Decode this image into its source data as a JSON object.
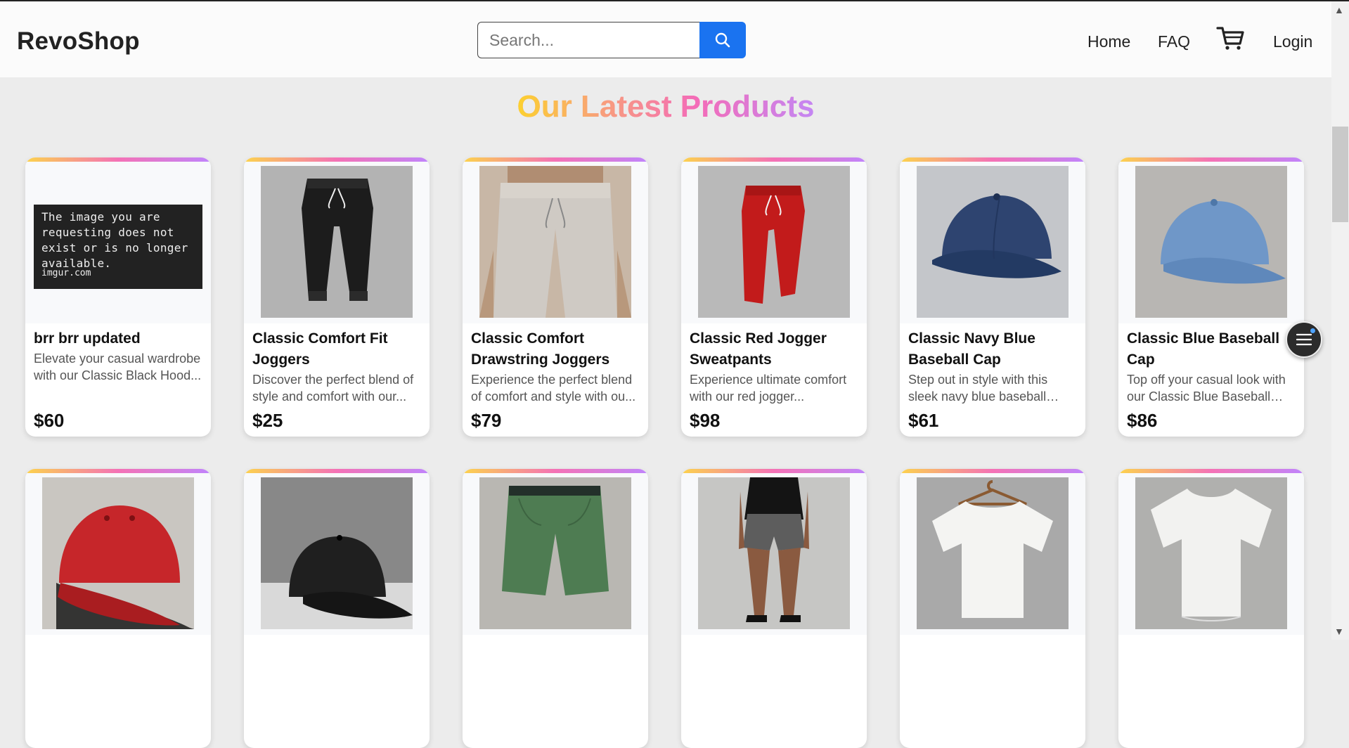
{
  "header": {
    "logo": "RevoShop",
    "search_placeholder": "Search...",
    "nav": {
      "home": "Home",
      "faq": "FAQ",
      "login": "Login"
    }
  },
  "section_title": "Our Latest Products",
  "broken_image": {
    "message": "The image you are requesting does not exist or is no longer available.",
    "site": "imgur.com"
  },
  "products": [
    {
      "name": "brr brr updated",
      "desc": "Elevate your casual wardrobe with our Classic Black Hood...",
      "price": "$60",
      "image": "broken-image"
    },
    {
      "name": "Classic Comfort Fit Joggers",
      "desc": "Discover the perfect blend of style and comfort with our...",
      "price": "$25",
      "image": "black-joggers"
    },
    {
      "name": "Classic Comfort Drawstring Joggers",
      "desc": "Experience the perfect blend of comfort and style with ou...",
      "price": "$79",
      "image": "grey-joggers"
    },
    {
      "name": "Classic Red Jogger Sweatpants",
      "desc": "Experience ultimate comfort with our red jogger...",
      "price": "$98",
      "image": "red-joggers"
    },
    {
      "name": "Classic Navy Blue Baseball Cap",
      "desc": "Step out in style with this sleek navy blue baseball cap...",
      "price": "$61",
      "image": "navy-cap"
    },
    {
      "name": "Classic Blue Baseball Cap",
      "desc": "Top off your casual look with our Classic Blue Baseball Ca...",
      "price": "$86",
      "image": "blue-cap"
    },
    {
      "name": "",
      "desc": "",
      "price": "",
      "image": "red-cap"
    },
    {
      "name": "",
      "desc": "",
      "price": "",
      "image": "black-cap"
    },
    {
      "name": "",
      "desc": "",
      "price": "",
      "image": "green-shorts"
    },
    {
      "name": "",
      "desc": "",
      "price": "",
      "image": "woman-shorts"
    },
    {
      "name": "",
      "desc": "",
      "price": "",
      "image": "white-tshirt-hanger"
    },
    {
      "name": "",
      "desc": "",
      "price": "",
      "image": "white-tshirt"
    }
  ],
  "colors": {
    "accent": "#1a73f0",
    "gradient": [
      "#fcd34d",
      "#f472b6",
      "#c084fc"
    ]
  }
}
